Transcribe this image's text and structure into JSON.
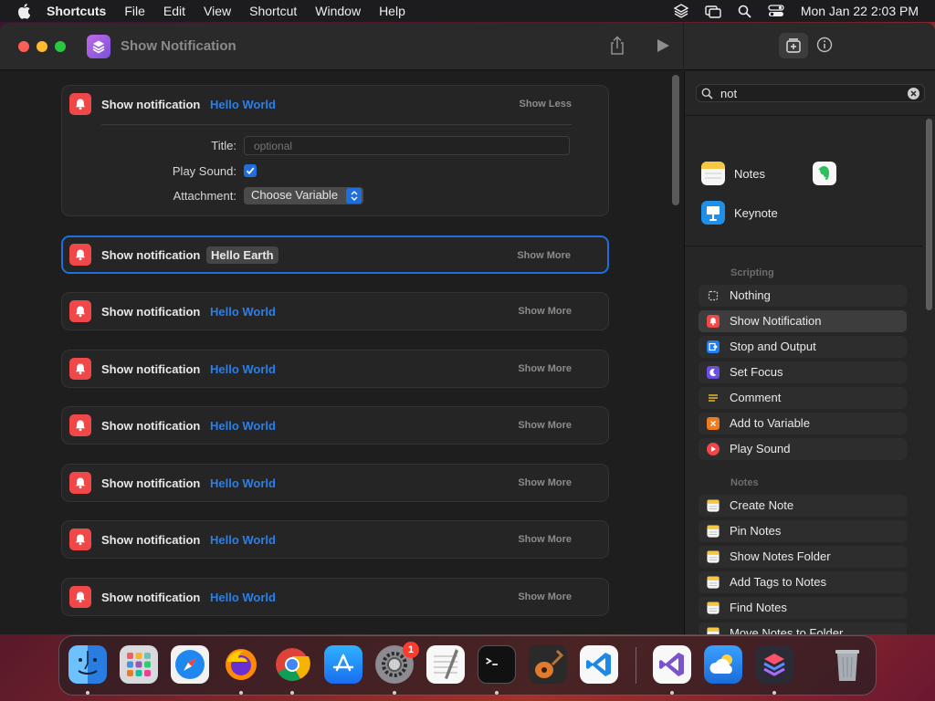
{
  "menubar": {
    "app": "Shortcuts",
    "items": [
      "File",
      "Edit",
      "View",
      "Shortcut",
      "Window",
      "Help"
    ],
    "clock": "Mon Jan 22  2:03 PM"
  },
  "window": {
    "title": "Show Notification"
  },
  "editor": {
    "expanded_card": {
      "title": "Show notification",
      "value": "Hello World",
      "toggle": "Show Less",
      "title_label": "Title:",
      "title_placeholder": "optional",
      "sound_label": "Play Sound:",
      "play_sound": true,
      "attachment_label": "Attachment:",
      "attachment_value": "Choose Variable"
    },
    "cards": [
      {
        "title": "Show notification",
        "value": "Hello Earth",
        "toggle": "Show More"
      },
      {
        "title": "Show notification",
        "value": "Hello World",
        "toggle": "Show More"
      },
      {
        "title": "Show notification",
        "value": "Hello World",
        "toggle": "Show More"
      },
      {
        "title": "Show notification",
        "value": "Hello World",
        "toggle": "Show More"
      },
      {
        "title": "Show notification",
        "value": "Hello World",
        "toggle": "Show More"
      },
      {
        "title": "Show notification",
        "value": "Hello World",
        "toggle": "Show More"
      },
      {
        "title": "Show notification",
        "value": "Hello World",
        "toggle": "Show More"
      }
    ]
  },
  "library": {
    "search_value": "not",
    "apps": [
      "Notes",
      "Keynote"
    ],
    "sections": [
      {
        "header": "Scripting",
        "actions": [
          {
            "label": "Nothing",
            "icon": "nothing-icon"
          },
          {
            "label": "Show Notification",
            "icon": "notification-icon"
          },
          {
            "label": "Stop and Output",
            "icon": "stop-output-icon"
          },
          {
            "label": "Set Focus",
            "icon": "moon-icon"
          },
          {
            "label": "Comment",
            "icon": "comment-icon"
          },
          {
            "label": "Add to Variable",
            "icon": "variable-icon"
          },
          {
            "label": "Play Sound",
            "icon": "play-sound-icon"
          }
        ]
      },
      {
        "header": "Notes",
        "actions": [
          {
            "label": "Create Note",
            "icon": "notes-icon"
          },
          {
            "label": "Pin Notes",
            "icon": "notes-icon"
          },
          {
            "label": "Show Notes Folder",
            "icon": "notes-icon"
          },
          {
            "label": "Add Tags to Notes",
            "icon": "notes-icon"
          },
          {
            "label": "Find Notes",
            "icon": "notes-icon"
          },
          {
            "label": "Move Notes to Folder",
            "icon": "notes-icon"
          }
        ]
      }
    ]
  },
  "dock": {
    "system_settings_badge": "1",
    "apps": [
      "finder",
      "launchpad",
      "safari",
      "firefox",
      "chrome",
      "app-store",
      "system-settings",
      "textedit",
      "terminal",
      "garageband",
      "vscode",
      "visual-studio",
      "weather",
      "shortcuts",
      "trash"
    ]
  },
  "colors": {
    "accent": "#1e6ede",
    "link_blue": "#2b7fe8",
    "notification_red": "#f04848"
  }
}
